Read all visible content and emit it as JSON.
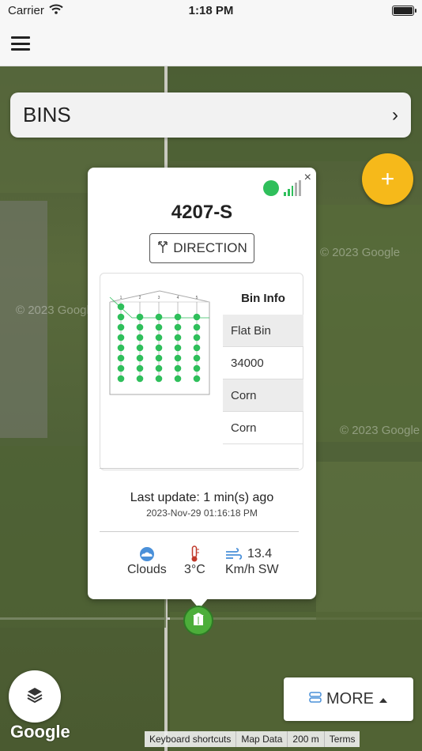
{
  "status_bar": {
    "carrier": "Carrier",
    "time": "1:18 PM"
  },
  "header": {
    "menu_icon": "hamburger-icon"
  },
  "bins_bar": {
    "title": "BINS",
    "chevron": "›"
  },
  "fab": {
    "label": "+"
  },
  "popup": {
    "bin_name": "4207-S",
    "direction_label": "DIRECTION",
    "close": "×",
    "status_color": "#2fbf5b",
    "bin_info_title": "Bin Info",
    "bin_info": [
      "Flat Bin",
      "34000",
      "Corn",
      "Corn"
    ],
    "diagram_columns": [
      "1",
      "2",
      "3",
      "4",
      "5"
    ],
    "last_update": "Last update: 1 min(s) ago",
    "update_time": "2023-Nov-29 01:16:18 PM",
    "weather": {
      "condition": "Clouds",
      "temperature": "3°C",
      "wind_speed": "13.4",
      "wind_unit": "Km/h SW"
    }
  },
  "map": {
    "watermarks": [
      "© 2023 Google",
      "© 2023 Google",
      "© 2023 Google"
    ],
    "google_logo": "Google",
    "more_label": "MORE",
    "attribution": [
      "Keyboard shortcuts",
      "Map Data",
      "200 m",
      "Terms"
    ]
  },
  "colors": {
    "accent": "#f6b91a",
    "sensor_green": "#2fbf5b",
    "marker_green": "#4cae3a"
  }
}
